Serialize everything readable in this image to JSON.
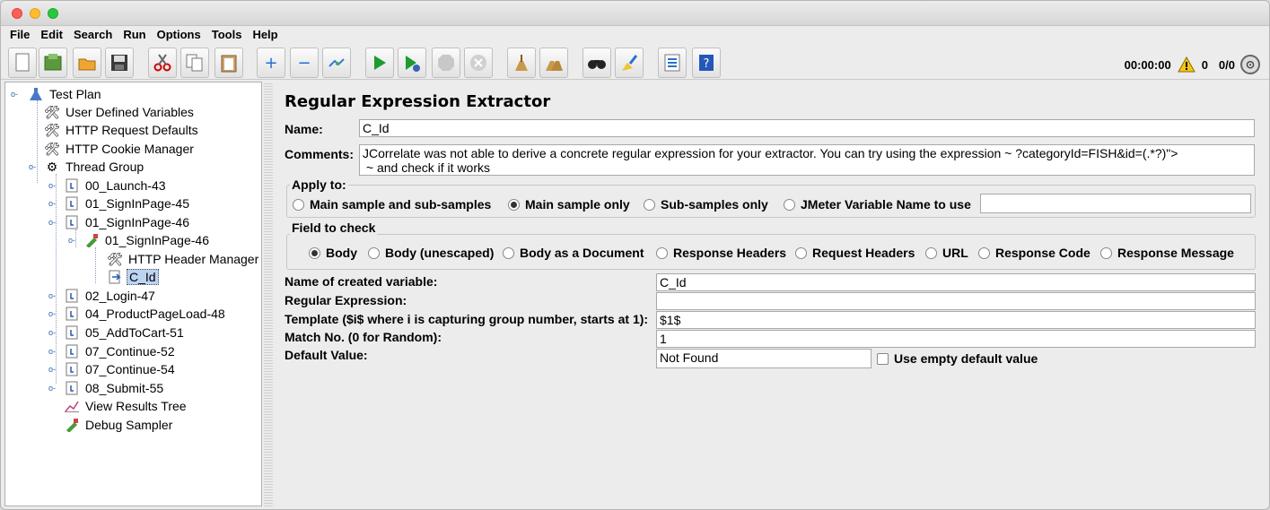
{
  "menu": [
    "File",
    "Edit",
    "Search",
    "Run",
    "Options",
    "Tools",
    "Help"
  ],
  "toolbar": {
    "icons": [
      "new-icon",
      "templates-icon",
      "open-icon",
      "save-icon",
      "cut-icon",
      "copy-icon",
      "paste-icon",
      "expand-icon",
      "collapse-icon",
      "toggle-icon",
      "start-icon",
      "start-no-pause-icon",
      "stop-icon",
      "shutdown-icon",
      "clear-icon",
      "clear-all-icon",
      "search-icon",
      "reset-search-icon",
      "function-helper-icon",
      "help-icon"
    ],
    "timer": "00:00:00",
    "warnings": "0",
    "threads": "0/0"
  },
  "tree": [
    {
      "label": "Test Plan",
      "icon": "test-plan-icon"
    },
    {
      "label": "User Defined Variables",
      "icon": "config-icon"
    },
    {
      "label": "HTTP Request Defaults",
      "icon": "config-icon"
    },
    {
      "label": "HTTP Cookie Manager",
      "icon": "config-icon"
    },
    {
      "label": "Thread Group",
      "icon": "thread-group-icon"
    },
    {
      "label": "00_Launch-43",
      "icon": "controller-icon"
    },
    {
      "label": "01_SignInPage-45",
      "icon": "controller-icon"
    },
    {
      "label": "01_SignInPage-46",
      "icon": "controller-icon"
    },
    {
      "label": "01_SignInPage-46",
      "icon": "sampler-icon"
    },
    {
      "label": "HTTP Header Manager",
      "icon": "config-icon"
    },
    {
      "label": "C_Id",
      "icon": "extractor-icon"
    },
    {
      "label": "02_Login-47",
      "icon": "controller-icon"
    },
    {
      "label": "04_ProductPageLoad-48",
      "icon": "controller-icon"
    },
    {
      "label": "05_AddToCart-51",
      "icon": "controller-icon"
    },
    {
      "label": "07_Continue-52",
      "icon": "controller-icon"
    },
    {
      "label": "07_Continue-54",
      "icon": "controller-icon"
    },
    {
      "label": "08_Submit-55",
      "icon": "controller-icon"
    },
    {
      "label": "View Results Tree",
      "icon": "listener-icon"
    },
    {
      "label": "Debug Sampler",
      "icon": "sampler-icon"
    }
  ],
  "panel": {
    "title": "Regular Expression Extractor",
    "name_label": "Name:",
    "name_value": "C_Id",
    "comments_label": "Comments:",
    "comments_value": "JCorrelate was not able to derive a concrete regular expression for your extractor. You can try using the expression ~ ?categoryId=FISH&id=(.*?)\">\n ~ and check if it works",
    "apply_to": {
      "title": "Apply to:",
      "options": [
        "Main sample and sub-samples",
        "Main sample only",
        "Sub-samples only",
        "JMeter Variable Name to use"
      ],
      "selected": "Main sample only",
      "variable_value": ""
    },
    "field_to_check": {
      "title": "Field to check",
      "options": [
        "Body",
        "Body (unescaped)",
        "Body as a Document",
        "Response Headers",
        "Request Headers",
        "URL",
        "Response Code",
        "Response Message"
      ],
      "selected": "Body"
    },
    "rows": [
      {
        "label": "Name of created variable:",
        "value": "C_Id"
      },
      {
        "label": "Regular Expression:",
        "value": ""
      },
      {
        "label": "Template ($i$ where i is capturing group number, starts at 1):",
        "value": "$1$"
      },
      {
        "label": "Match No. (0 for Random):",
        "value": "1"
      },
      {
        "label": "Default Value:",
        "value": "Not Found"
      }
    ],
    "empty_default_label": "Use empty default value"
  }
}
